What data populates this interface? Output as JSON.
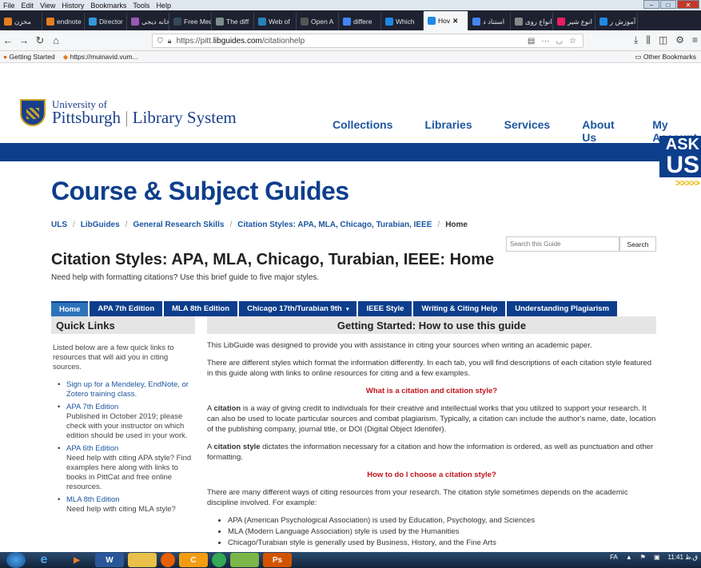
{
  "menubar": {
    "items": [
      "File",
      "Edit",
      "View",
      "History",
      "Bookmarks",
      "Tools",
      "Help"
    ]
  },
  "tabs": [
    {
      "label": "مخزن",
      "color": "#e67e22"
    },
    {
      "label": "endnote",
      "color": "#e67e22"
    },
    {
      "label": "Director",
      "color": "#3498db"
    },
    {
      "label": "کتابخانه دیجی",
      "color": "#9b59b6"
    },
    {
      "label": "Free Medic",
      "color": "#34495e"
    },
    {
      "label": "The diff",
      "color": "#7f8c8d"
    },
    {
      "label": "Web of",
      "color": "#2980b9"
    },
    {
      "label": "Open A",
      "color": "#555"
    },
    {
      "label": "differe",
      "color": "#4285f4"
    },
    {
      "label": "Which",
      "color": "#1e88e5"
    },
    {
      "label": "Hov",
      "color": "#1e88e5",
      "active": true
    },
    {
      "label": "استناد د",
      "color": "#4285f4"
    },
    {
      "label": "انواع روی",
      "color": "#888"
    },
    {
      "label": "انوع شیر",
      "color": "#e91e63"
    },
    {
      "label": "آموزش ر",
      "color": "#1e88e5"
    }
  ],
  "navbar": {
    "url_prefix": "https://pitt.",
    "url_domain": "libguides.com",
    "url_path": "/citationhelp",
    "dots": "···"
  },
  "bookmarks": {
    "items": [
      "Getting Started",
      "https://muinavid.vum..."
    ],
    "other": "Other Bookmarks"
  },
  "header": {
    "univ_of": "University of",
    "pitt": "Pittsburgh",
    "library": "Library System",
    "nav": [
      "Collections",
      "Libraries",
      "Services",
      "About Us",
      "My Account"
    ],
    "ask": "ASK",
    "us": "US",
    "arrows": ">>>>>"
  },
  "page": {
    "big_title": "Course & Subject Guides",
    "breadcrumb": [
      "ULS",
      "LibGuides",
      "General Research Skills",
      "Citation Styles: APA, MLA, Chicago, Turabian, IEEE",
      "Home"
    ],
    "search_placeholder": "Search this Guide",
    "search_button": "Search",
    "guide_title": "Citation Styles: APA, MLA, Chicago, Turabian, IEEE: Home",
    "guide_sub": "Need help with formatting citations? Use this brief guide to five major styles."
  },
  "guide_tabs": [
    "Home",
    "APA 7th Edition",
    "MLA 8th Edition",
    "Chicago 17th/Turabian 9th",
    "IEEE Style",
    "Writing & Citing Help",
    "Understanding Plagiarism"
  ],
  "quick_links": {
    "title": "Quick Links",
    "intro": "Listed below are a few quick links to resources that will aid you in citing sources.",
    "items": [
      {
        "link": "Sign up for a Mendeley, EndNote, or Zotero training class.",
        "desc": ""
      },
      {
        "link": "APA 7th Edition",
        "desc": "Published in October 2019; please check with your instructor on which edition should be used in your work."
      },
      {
        "link": "APA 6th Edition",
        "desc": "Need help with citing APA style? Find examples here along with links to books in PittCat and free online resources."
      },
      {
        "link": "MLA 8th Edition",
        "desc": "Need help with citing MLA style?"
      }
    ]
  },
  "main": {
    "title": "Getting Started: How to use this guide",
    "p1": "This LibGuide was designed to provide you with assistance in citing your sources when writing an academic paper.",
    "p2": "There are different styles which format the information differently. In each tab, you will find descriptions of each citation style featured in this guide along with links to online resources for citing and a few examples.",
    "h1": "What is a citation and citation style?",
    "p3_a": "A ",
    "p3_b": "citation",
    "p3_c": " is a way of giving credit to individuals for their creative and intellectual works that you utilized to support your research. It can also be used to locate particular sources and combat plagiarism. Typically, a citation can include the author's name, date, location of the publishing company, journal title, or DOI (Digital Object Identifer).",
    "p4_a": "A ",
    "p4_b": "citation style",
    "p4_c": " dictates the information necessary for a citation and how the information is ordered, as well as punctuation and other formatting.",
    "h2": "How to do I choose a citation style?",
    "p5": "There are many different ways of citing resources from your research. The citation style sometimes depends on the academic discipline involved. For example:",
    "list": [
      "APA (American Psychological Association) is used by Education, Psychology, and Sciences",
      "MLA (Modern Language Association) style is used by the Humanities",
      "Chicago/Turabian style is generally used by Business, History, and the Fine Arts"
    ]
  },
  "taskbar": {
    "lang": "FA",
    "time": "11:41 ق.ظ"
  }
}
